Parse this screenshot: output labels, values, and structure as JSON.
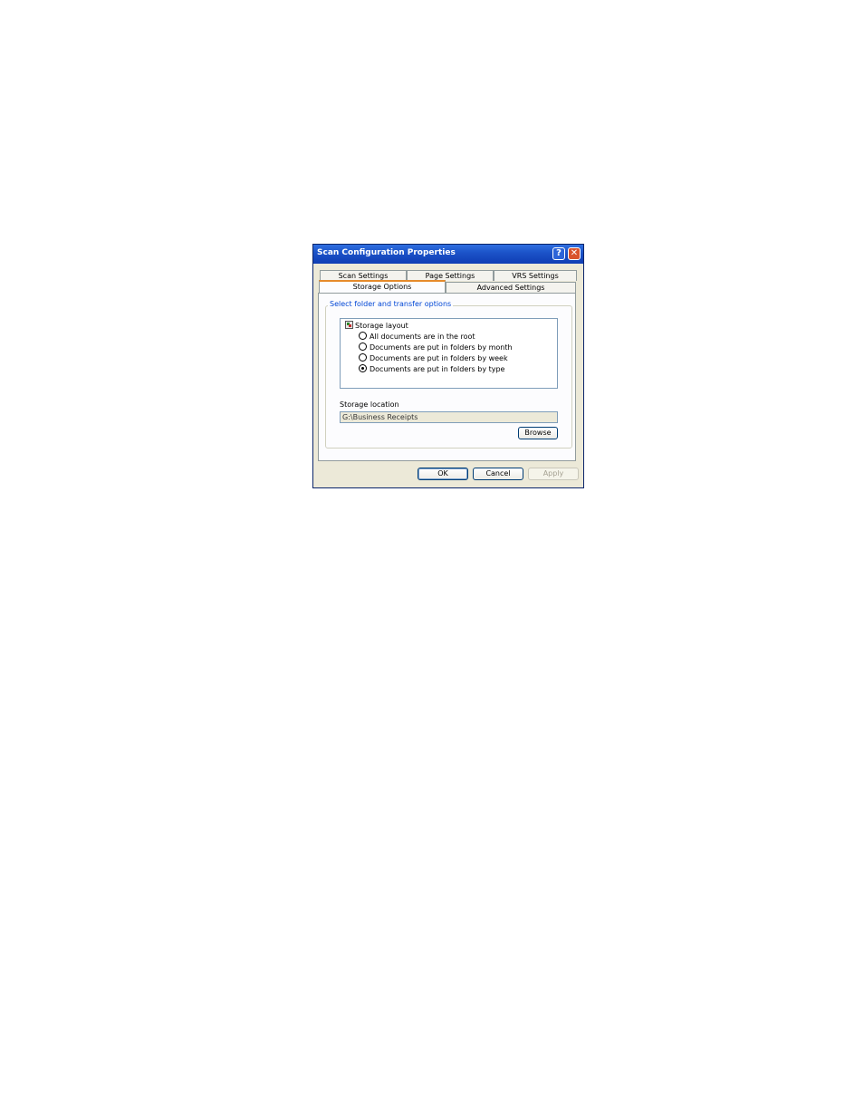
{
  "window": {
    "title": "Scan Configuration Properties"
  },
  "titlebar_buttons": {
    "help": "?",
    "close": "✕"
  },
  "tabs": {
    "row_back": [
      "Scan Settings",
      "Page Settings",
      "VRS Settings"
    ],
    "row_front": [
      "Storage Options",
      "Advanced Settings"
    ],
    "active": "Storage Options"
  },
  "group": {
    "label": "Select folder and transfer options"
  },
  "storage_layout": {
    "root_label": "Storage layout",
    "options": [
      {
        "label": "All documents are in the root",
        "checked": false
      },
      {
        "label": "Documents are put in folders by month",
        "checked": false
      },
      {
        "label": "Documents are put in folders by week",
        "checked": false
      },
      {
        "label": "Documents are put in folders by type",
        "checked": true
      }
    ]
  },
  "storage_location": {
    "label": "Storage location",
    "value": "G:\\Business Receipts"
  },
  "buttons": {
    "browse": "Browse",
    "ok": "OK",
    "cancel": "Cancel",
    "apply": "Apply"
  },
  "colors": {
    "titlebar": "#1c54c9",
    "active_tab_accent": "#e68b2c",
    "group_label": "#0046d5"
  }
}
